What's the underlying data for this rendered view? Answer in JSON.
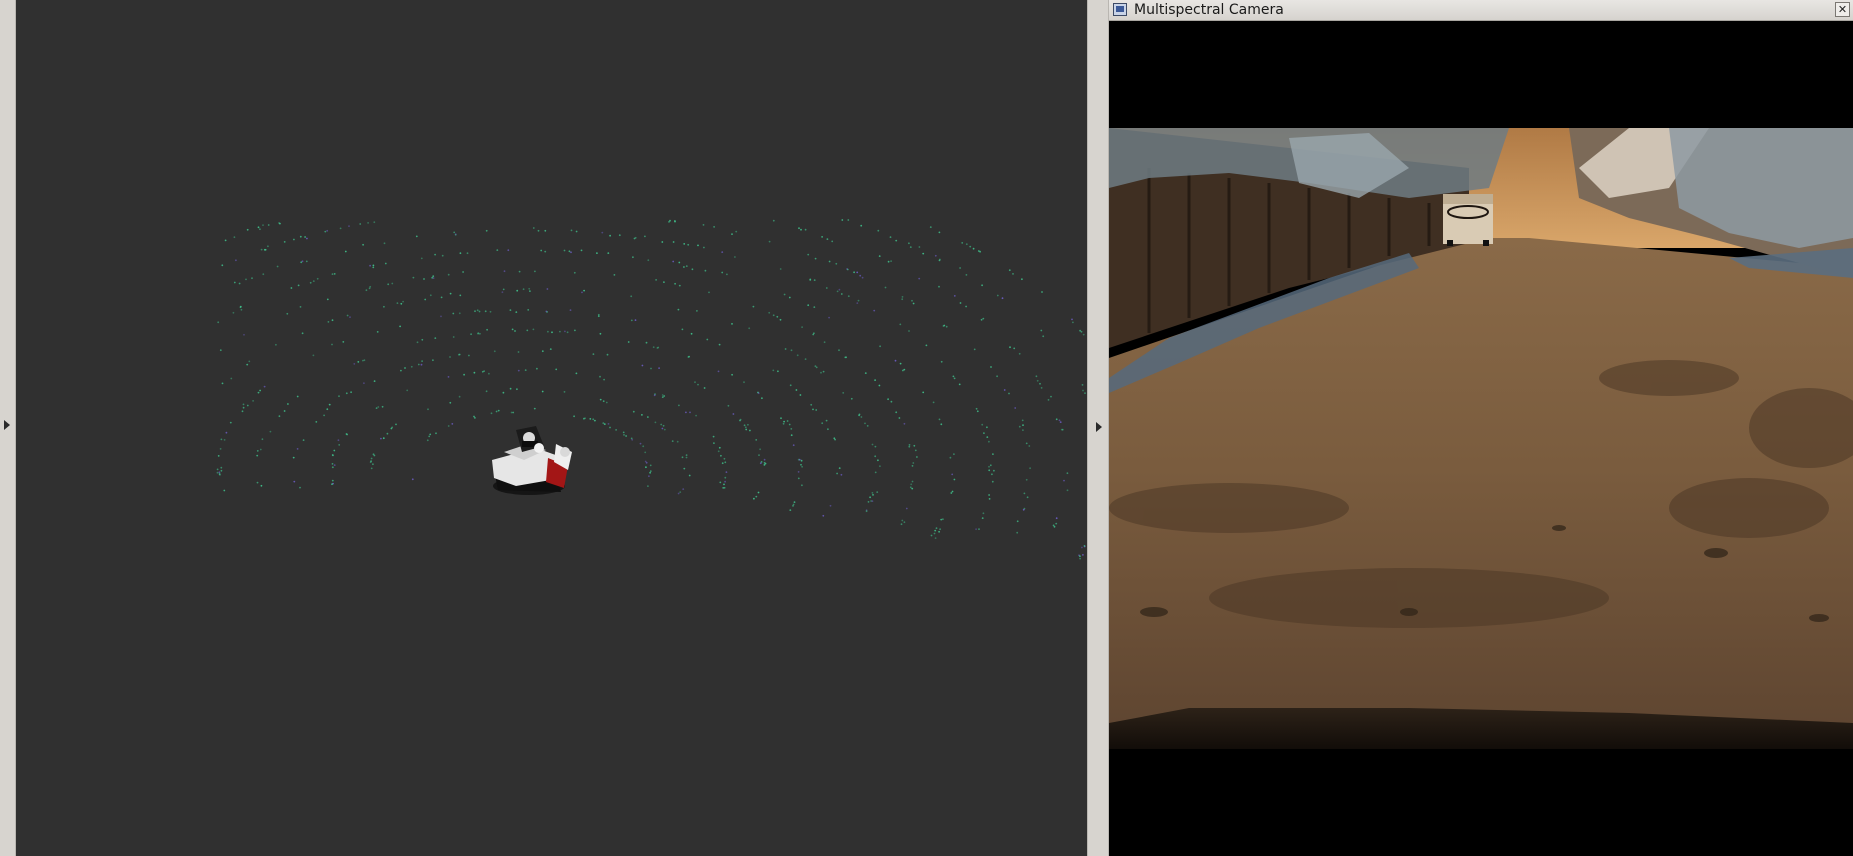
{
  "camera_window": {
    "title": "Multispectral Camera",
    "close_glyph": "✕",
    "window_icon": "window-icon"
  },
  "viewport": {
    "background_color": "#303030",
    "point_color": "#3fbf8a",
    "robot_colors": {
      "body": "#e8e8e8",
      "accent": "#b01818",
      "dark": "#111111"
    }
  },
  "panels": {
    "left_toggle_icon": "triangle-right-icon",
    "splitter_toggle_icon": "triangle-right-icon"
  }
}
